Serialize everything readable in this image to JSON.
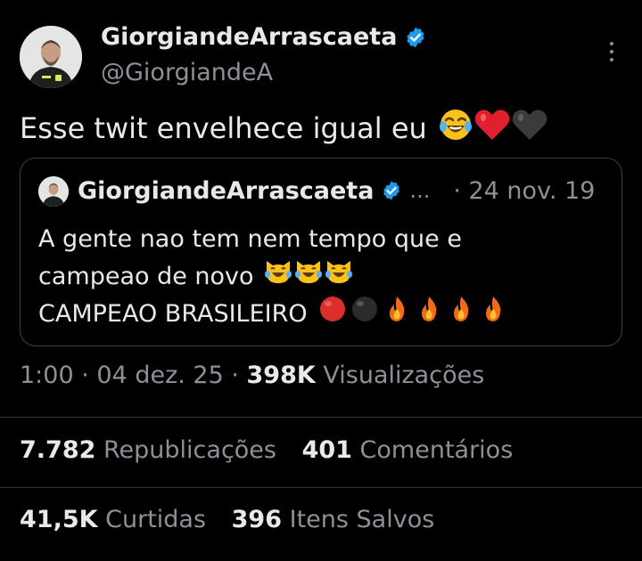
{
  "author": {
    "display_name": "GiorgiandeArrascaeta",
    "handle": "@GiorgiandeA",
    "verified_color": "#1d9bf0"
  },
  "tweet": {
    "text": "Esse twit envelhece igual eu",
    "emojis": [
      "face-with-tears-of-joy",
      "red-heart",
      "black-heart"
    ]
  },
  "quote": {
    "display_name": "GiorgiandeArrascaeta",
    "ellipsis": "...",
    "date": "· 24 nov. 19",
    "line1": "A gente nao tem nem tempo que e",
    "line2": "campeao de novo",
    "line2_emojis": [
      "cat-with-tears-of-joy",
      "cat-with-tears-of-joy",
      "cat-with-tears-of-joy"
    ],
    "line3": "CAMPEAO BRASILEIRO",
    "line3_emojis": [
      "red-circle",
      "black-circle",
      "fire",
      "fire",
      "fire",
      "fire"
    ]
  },
  "meta": {
    "time_date": "1:00 · 04 dez. 25 · ",
    "views_count": "398K",
    "views_label": " Visualizações"
  },
  "stats": {
    "reposts_count": "7.782",
    "reposts_label": "Republicações",
    "comments_count": "401",
    "comments_label": "Comentários",
    "likes_count": "41,5K",
    "likes_label": "Curtidas",
    "saves_count": "396",
    "saves_label": "Itens Salvos"
  }
}
